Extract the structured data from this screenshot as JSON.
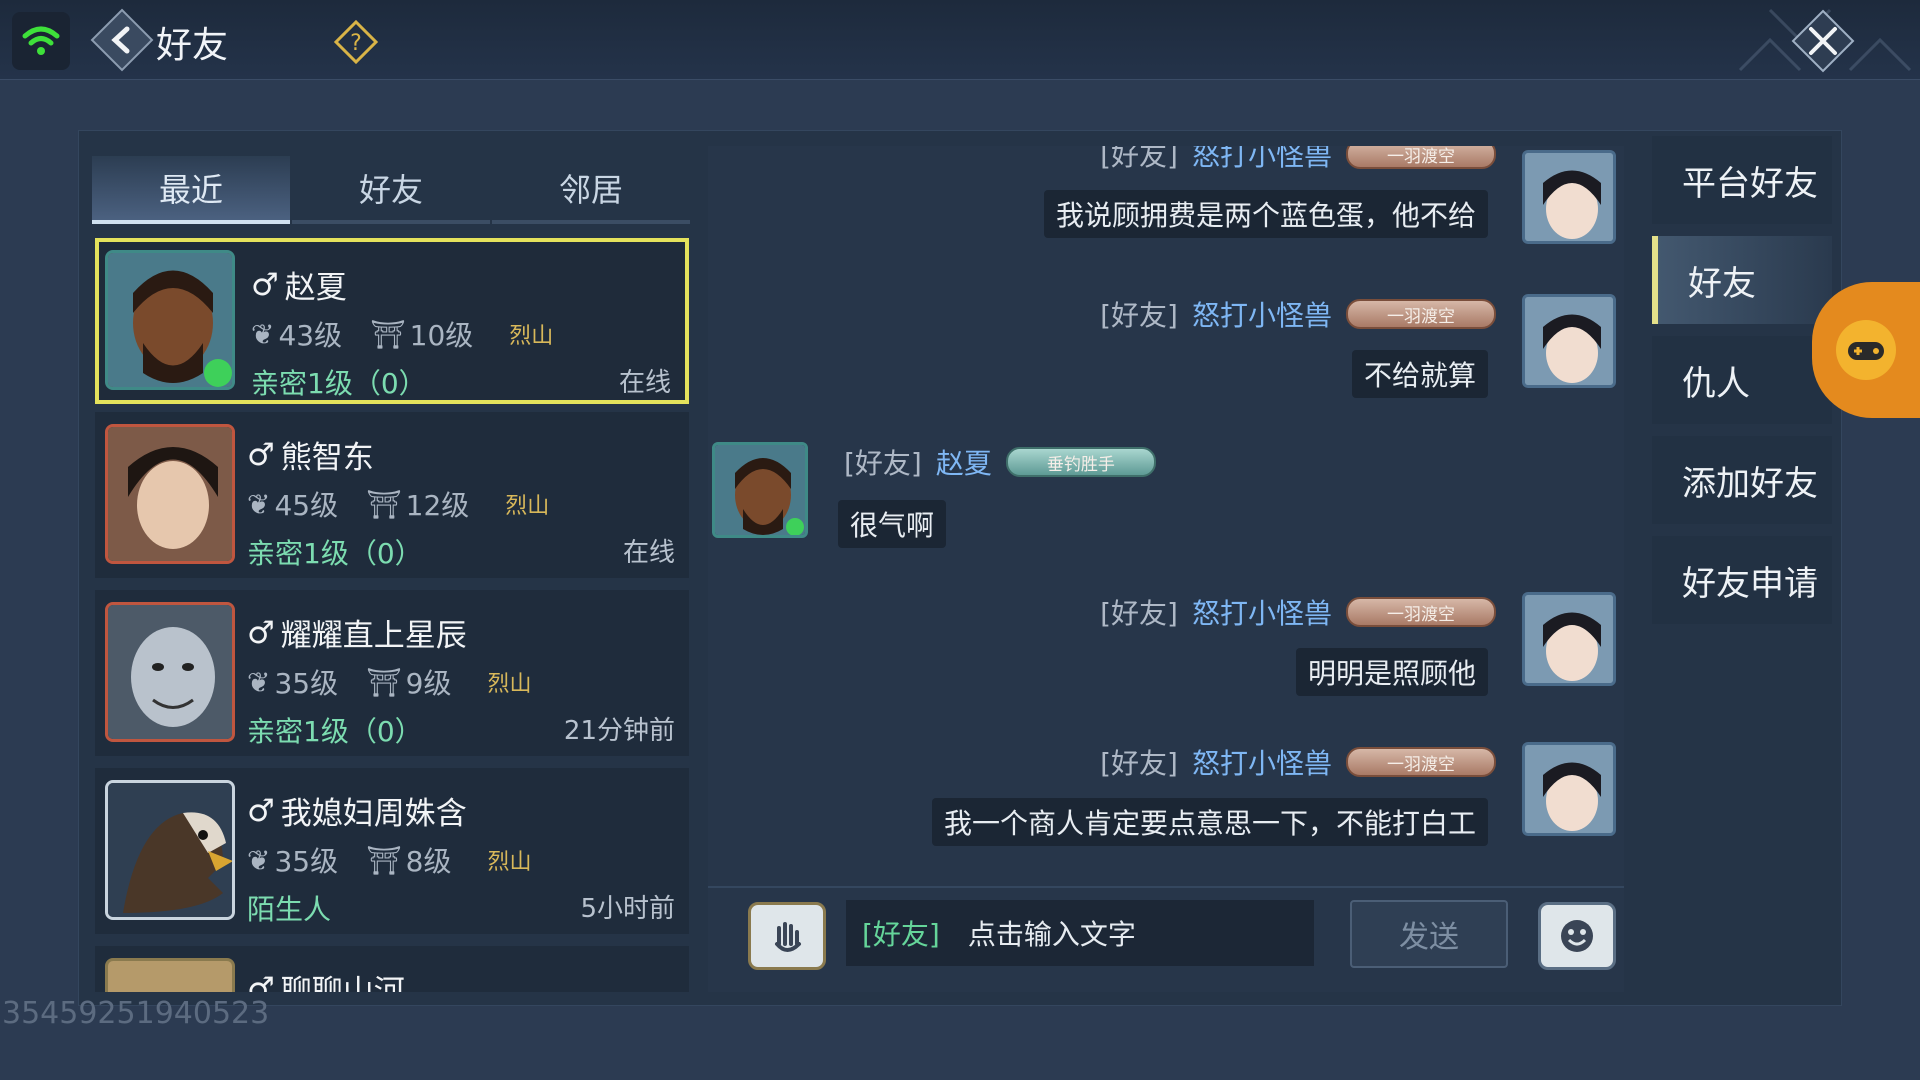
{
  "header": {
    "title": "好友"
  },
  "tabs": [
    "最近",
    "好友",
    "邻居"
  ],
  "friends": [
    {
      "gender": "♂",
      "name": "赵夏",
      "level": "43级",
      "house": "10级",
      "sect": "烈山",
      "intimacy": "亲密1级（0）",
      "status": "在线"
    },
    {
      "gender": "♂",
      "name": "熊智东",
      "level": "45级",
      "house": "12级",
      "sect": "烈山",
      "intimacy": "亲密1级（0）",
      "status": "在线"
    },
    {
      "gender": "♂",
      "name": "耀耀直上星辰",
      "level": "35级",
      "house": "9级",
      "sect": "烈山",
      "intimacy": "亲密1级（0）",
      "status": "21分钟前"
    },
    {
      "gender": "♂",
      "name": "我媳妇周姝含",
      "level": "35级",
      "house": "8级",
      "sect": "烈山",
      "intimacy": "陌生人",
      "status": "5小时前"
    },
    {
      "gender": "♂",
      "name": "聊聊山河"
    }
  ],
  "chat": {
    "messages": [
      {
        "side": "right",
        "tag": "[好友]",
        "name": "怒打小怪兽",
        "badge": "一羽渡空",
        "text": "我说顾拥费是两个蓝色蛋，他不给"
      },
      {
        "side": "right",
        "tag": "[好友]",
        "name": "怒打小怪兽",
        "badge": "一羽渡空",
        "text": "不给就算"
      },
      {
        "side": "left",
        "tag": "[好友]",
        "name": "赵夏",
        "badge": "垂钓胜手",
        "text": "很气啊"
      },
      {
        "side": "right",
        "tag": "[好友]",
        "name": "怒打小怪兽",
        "badge": "一羽渡空",
        "text": "明明是照顾他"
      },
      {
        "side": "right",
        "tag": "[好友]",
        "name": "怒打小怪兽",
        "badge": "一羽渡空",
        "text": "我一个商人肯定要点意思一下，不能打白工"
      }
    ]
  },
  "input": {
    "channel": "[好友]",
    "placeholder": "点击输入文字",
    "send_label": "发送"
  },
  "side_menu": [
    "平台好友",
    "好友",
    "仇人",
    "添加好友",
    "好友申请"
  ],
  "watermark": "35459251940523",
  "colors": {
    "background": "#2c3b52",
    "selected_border": "#e4e25c",
    "intimacy_green": "#7cdcb0",
    "name_blue": "#7fb7f4",
    "float_orange": "#e48a1e"
  }
}
